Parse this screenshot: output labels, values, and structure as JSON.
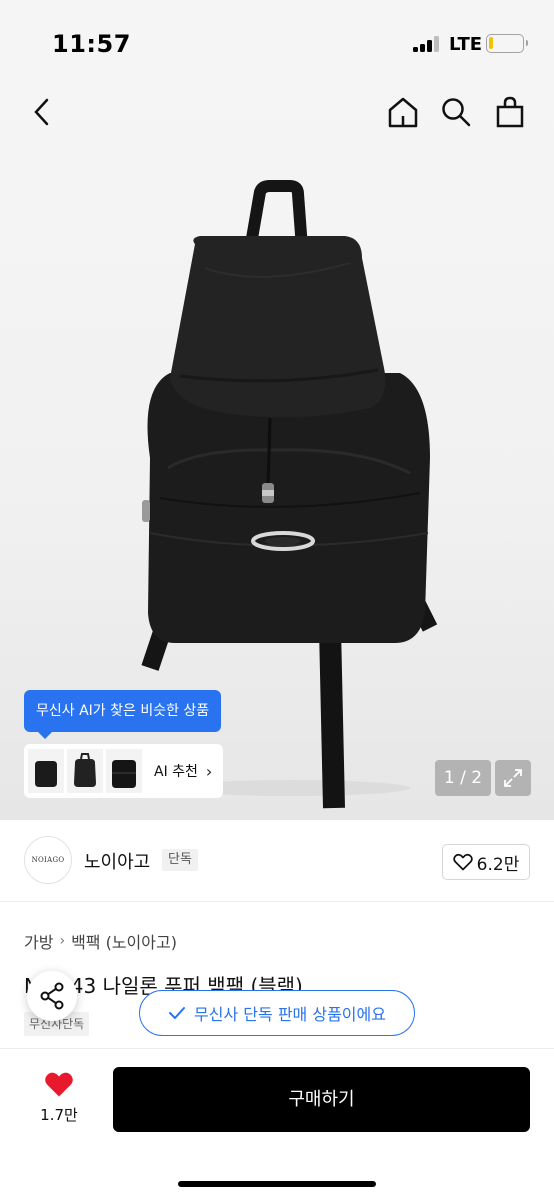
{
  "status": {
    "time": "11:57",
    "network": "LTE",
    "battery_level": 0.12
  },
  "nav": {
    "back": "back-icon",
    "home": "home-icon",
    "search": "search-icon",
    "cart": "shopping-bag-icon"
  },
  "ai": {
    "tooltip": "무신사 AI가 찾은 비슷한 상품",
    "button_label": "AI 추천"
  },
  "gallery": {
    "counter": "1 / 2"
  },
  "brand": {
    "logo_text": "NOIAGO",
    "name": "노이아고",
    "badge": "단독",
    "likes": "6.2만"
  },
  "breadcrumb": {
    "items": [
      "가방",
      "백팩 (노이아고)"
    ]
  },
  "product": {
    "title": "N 1343 나일론 푸퍼 백팩 (블랙)",
    "tag": "무신사단독"
  },
  "exclusive": {
    "label": "무신사 단독 판매 상품이에요"
  },
  "bottom": {
    "wish_count": "1.7만",
    "buy_label": "구매하기"
  },
  "colors": {
    "accent": "#2a73f0",
    "wish": "#e8192c",
    "buy": "#000000"
  }
}
